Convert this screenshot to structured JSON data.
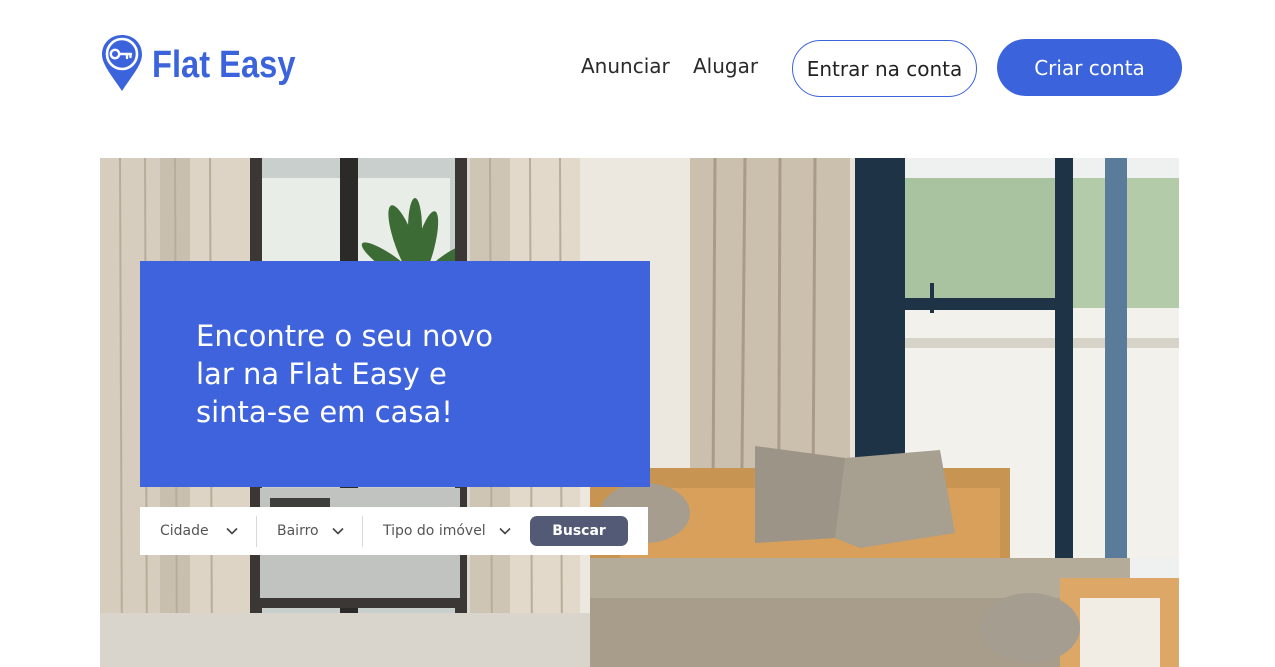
{
  "brand": {
    "name": "Flat Easy",
    "logo_icon": "key-pin-icon",
    "accent_color": "#3b63dc"
  },
  "nav": {
    "links": [
      {
        "label": "Anunciar"
      },
      {
        "label": "Alugar"
      }
    ],
    "login_label": "Entrar na conta",
    "signup_label": "Criar conta"
  },
  "hero": {
    "title": "Encontre o seu novo lar na Flat Easy e sinta-se em casa!",
    "image": "living-room-with-sofa-photo"
  },
  "search": {
    "filters": [
      {
        "label": "Cidade",
        "icon": "chevron-down-icon"
      },
      {
        "label": "Bairro",
        "icon": "chevron-down-icon"
      },
      {
        "label": "Tipo do imóvel",
        "icon": "chevron-down-icon"
      }
    ],
    "button_label": "Buscar",
    "button_color": "#535a75"
  }
}
